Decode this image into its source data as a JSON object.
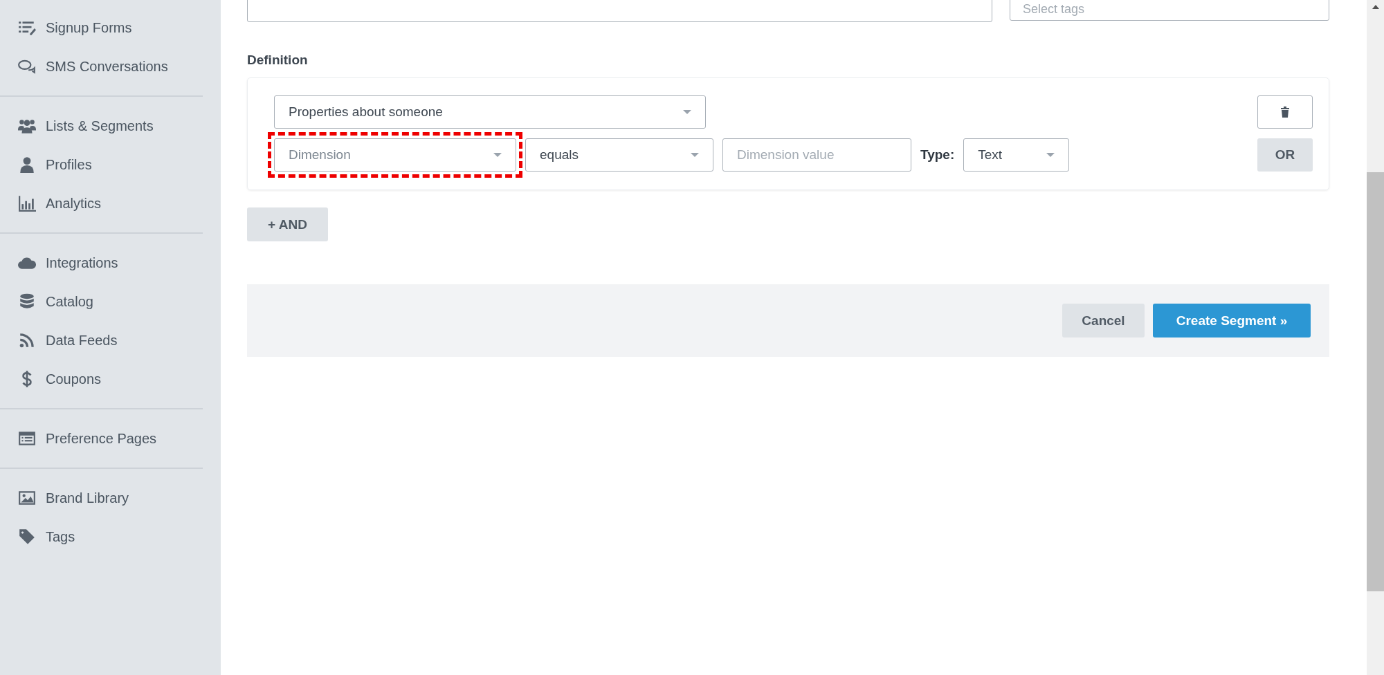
{
  "sidebar": {
    "groups": [
      {
        "items": [
          {
            "label": "Signup Forms"
          },
          {
            "label": "SMS Conversations"
          }
        ]
      },
      {
        "items": [
          {
            "label": "Lists & Segments"
          },
          {
            "label": "Profiles"
          },
          {
            "label": "Analytics"
          }
        ]
      },
      {
        "items": [
          {
            "label": "Integrations"
          },
          {
            "label": "Catalog"
          },
          {
            "label": "Data Feeds"
          },
          {
            "label": "Coupons"
          }
        ]
      },
      {
        "items": [
          {
            "label": "Preference Pages"
          }
        ]
      },
      {
        "items": [
          {
            "label": "Brand Library"
          },
          {
            "label": "Tags"
          }
        ]
      }
    ]
  },
  "top_fields": {
    "tags": {
      "placeholder": "Select tags"
    }
  },
  "definition": {
    "label": "Definition",
    "condition_type": {
      "value": "Properties about someone"
    },
    "dimension": {
      "placeholder": "Dimension",
      "highlighted": true
    },
    "operator": {
      "value": "equals"
    },
    "dimension_value": {
      "placeholder": "Dimension value"
    },
    "type_label": "Type:",
    "type": {
      "value": "Text"
    },
    "or_button": "OR",
    "and_button": "+ AND"
  },
  "footer": {
    "cancel": "Cancel",
    "create": "Create Segment »"
  }
}
